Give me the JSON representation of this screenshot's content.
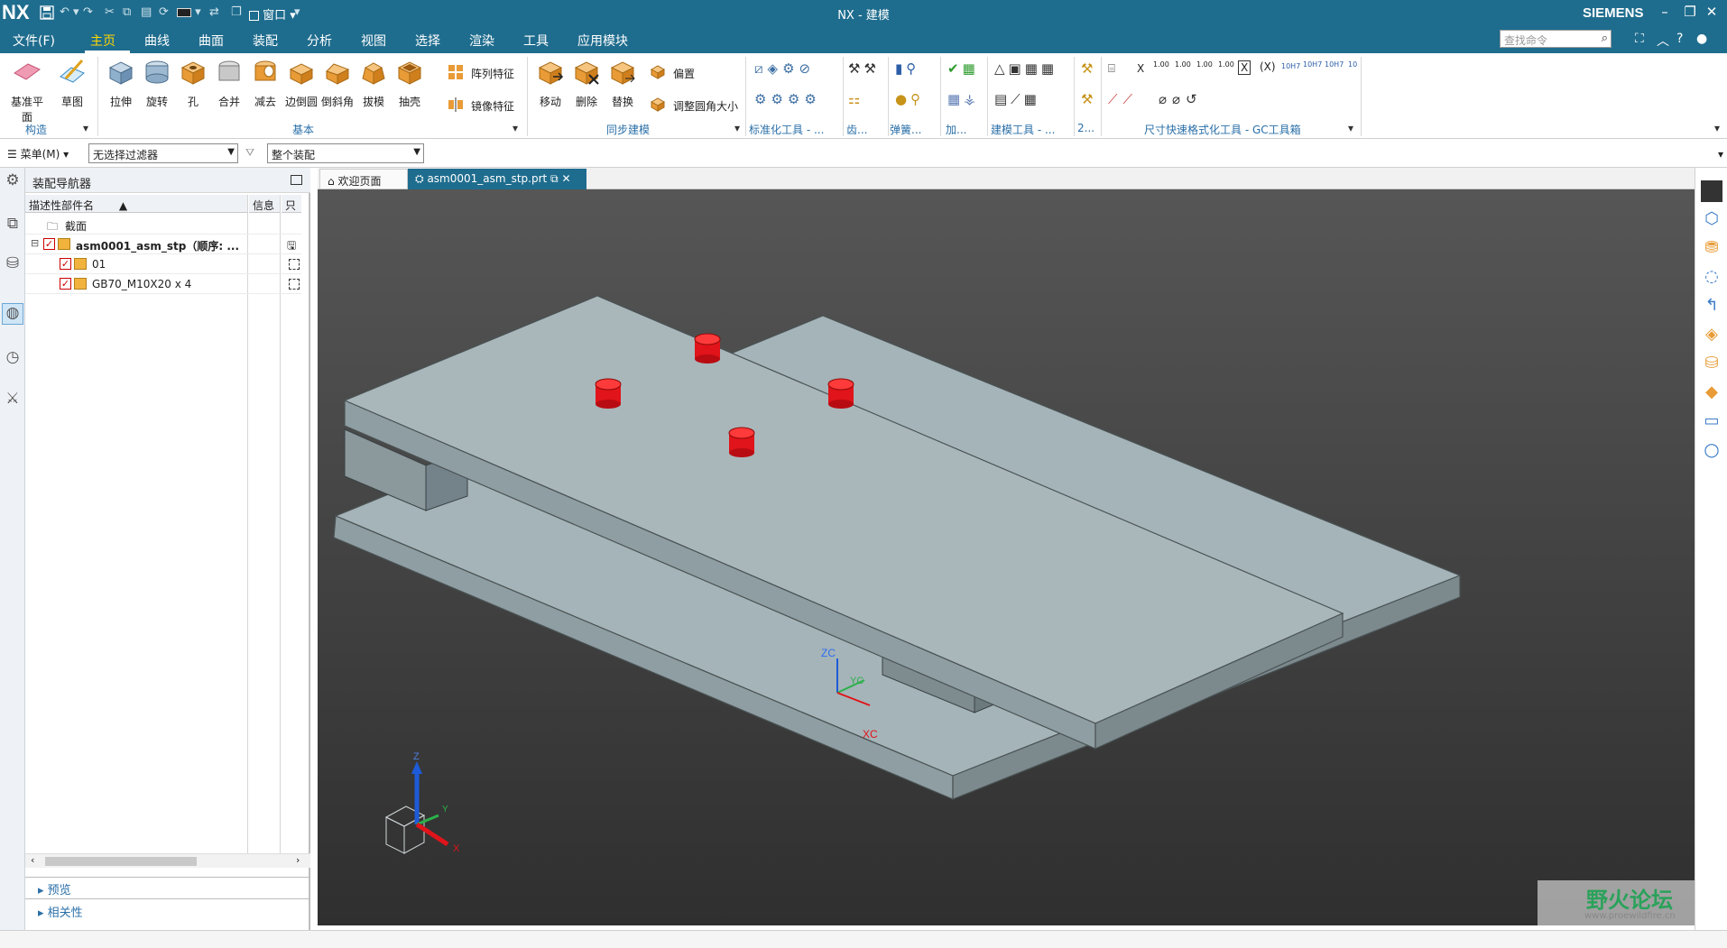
{
  "app": {
    "logo": "NX",
    "window_menu": "窗口",
    "title": "NX - 建模",
    "vendor": "SIEMENS"
  },
  "menubar": {
    "file": "文件(F)",
    "tabs": [
      "主页",
      "曲线",
      "曲面",
      "装配",
      "分析",
      "视图",
      "选择",
      "渲染",
      "工具",
      "应用模块"
    ],
    "active_tab": "主页",
    "search_placeholder": "查找命令"
  },
  "ribbon": {
    "construct": {
      "datum_plane": "基准平面",
      "sketch": "草图",
      "group_label": "构造"
    },
    "basic": {
      "tools": [
        "拉伸",
        "旋转",
        "孔",
        "合并",
        "减去",
        "边倒圆",
        "倒斜角",
        "拔模",
        "抽壳"
      ],
      "pattern": "阵列特征",
      "mirror": "镜像特征",
      "group_label": "基本"
    },
    "sync": {
      "tools": [
        "移动",
        "删除",
        "替换"
      ],
      "offset": "偏置",
      "resize_blend": "调整圆角大小",
      "group_label": "同步建模"
    },
    "more_groups": [
      "标准化工具 - ...",
      "齿...",
      "弹簧...",
      "加...",
      "建模工具 - ...",
      "2...",
      "尺寸快速格式化工具 - GC工具箱"
    ],
    "dim_labels": [
      "X",
      "1.00",
      "1.00",
      "1.00",
      "1.00",
      "(X)",
      "10H7",
      "10H7",
      "10H7",
      "10"
    ]
  },
  "filterbar": {
    "menu": "菜单(M)",
    "filter": "无选择过滤器",
    "scope": "整个装配"
  },
  "navigator": {
    "title": "装配导航器",
    "columns": {
      "name": "描述性部件名",
      "info": "信息",
      "readonly": "只"
    },
    "rows": [
      {
        "label": "截面",
        "level": 1
      },
      {
        "label": "asm0001_asm_stp（顺序: ...",
        "level": 1
      },
      {
        "label": "01",
        "level": 2
      },
      {
        "label": "GB70_M10X20 x 4",
        "level": 2
      }
    ],
    "sections": [
      "预览",
      "相关性"
    ]
  },
  "tabs": [
    {
      "label": "欢迎页面"
    },
    {
      "label": "asm0001_asm_stp.prt"
    }
  ],
  "viewport": {
    "wcs": {
      "z": "ZC",
      "y": "YC",
      "x": "XC"
    },
    "triad": {
      "z": "Z",
      "y": "Y",
      "x": "X"
    }
  },
  "watermark": {
    "title": "野火论坛",
    "url": "www.proewildfire.cn"
  },
  "colors": {
    "title_bg": "#1f6d8e",
    "model_face": "#a9b7bb",
    "bolt": "#e0141a",
    "canvas_top": "#565656",
    "canvas_bottom": "#2f2f2f"
  }
}
